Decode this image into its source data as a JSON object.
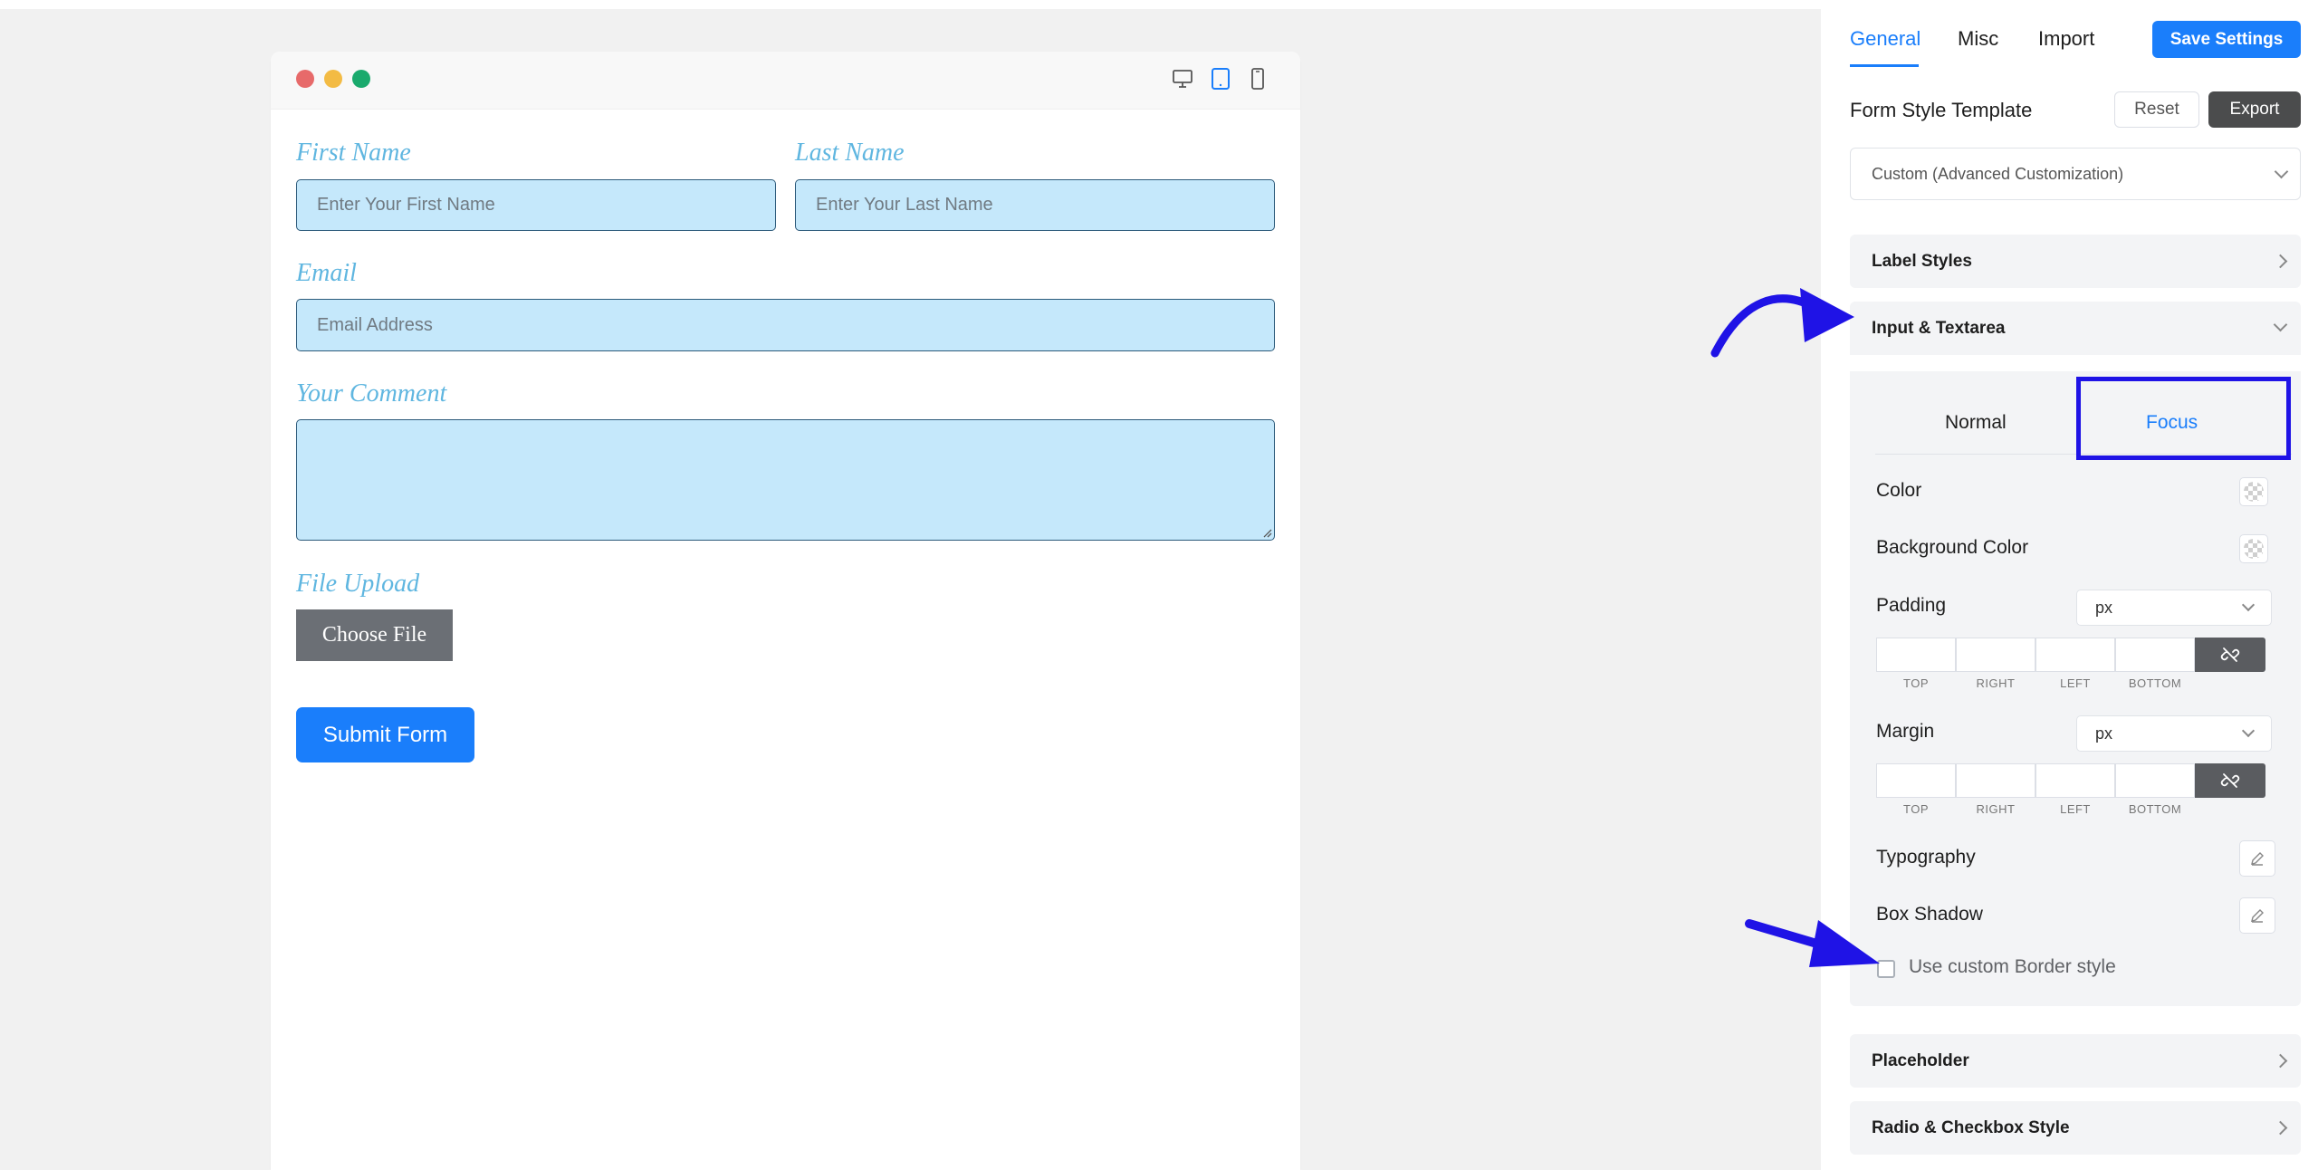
{
  "preview": {
    "devices": [
      "desktop-icon",
      "tablet-icon",
      "mobile-icon"
    ],
    "fields": {
      "first_name_label": "First Name",
      "first_name_placeholder": "Enter Your First Name",
      "last_name_label": "Last Name",
      "last_name_placeholder": "Enter Your Last Name",
      "email_label": "Email",
      "email_placeholder": "Email Address",
      "comment_label": "Your Comment",
      "file_label": "File Upload",
      "choose_file": "Choose File",
      "submit": "Submit Form"
    }
  },
  "panel": {
    "tabs": [
      {
        "label": "General",
        "active": true
      },
      {
        "label": "Misc",
        "active": false
      },
      {
        "label": "Import",
        "active": false
      }
    ],
    "save_label": "Save Settings",
    "template_heading": "Form Style Template",
    "reset_label": "Reset",
    "export_label": "Export",
    "template_value": "Custom (Advanced Customization)",
    "sections": {
      "label_styles": "Label Styles",
      "input_textarea": "Input & Textarea",
      "placeholder": "Placeholder",
      "radio_checkbox": "Radio & Checkbox Style"
    },
    "input_tabs": {
      "normal": "Normal",
      "focus": "Focus"
    },
    "props": {
      "color": "Color",
      "background_color": "Background Color",
      "padding": "Padding",
      "padding_unit": "px",
      "margin": "Margin",
      "margin_unit": "px",
      "typography": "Typography",
      "box_shadow": "Box Shadow",
      "custom_border": "Use custom Border style"
    },
    "box_captions": [
      "TOP",
      "RIGHT",
      "LEFT",
      "BOTTOM"
    ]
  },
  "colors": {
    "accent": "#1a7efb",
    "annotation": "#1f13e6",
    "field_bg": "#c5e8fb",
    "label_color": "#5fb6e0"
  }
}
